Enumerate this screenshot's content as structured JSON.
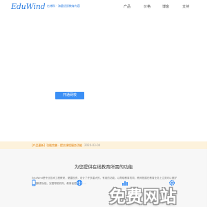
{
  "header": {
    "logo_text": "EduWind",
    "tagline": "亿博科 · 海量优质教育内容",
    "nav": {
      "products": "产品",
      "pricing": "价格",
      "blog": "博客",
      "support": "支持"
    }
  },
  "hero": {
    "cta_label": "开通网校"
  },
  "notice": {
    "tag": "[产品更新]",
    "title": "功能完善 · 提交课程服务功能",
    "date": "2020-03-04"
  },
  "features": {
    "title": "为您提供在线教育所需的功能",
    "description": "EduWind是专业技术工程教研，便捷投资，设计了许多重大的，有用的功能，以帮助教育机构，教师拓展在教育业务上立刻可以做好开展教课功能，完善帮助机构，教育者更好地……"
  },
  "watermark": {
    "text": "免费网站"
  },
  "colors": {
    "brand_blue": "#2b7de0",
    "button_blue": "#3b8ff5",
    "notice_bg": "#fdf2dc",
    "notice_text": "#e07b00",
    "features_bg": "#f7f7f7"
  },
  "icons": [
    "mobile-icon",
    "film-reel-icon",
    "chart-icon",
    "gear-icon"
  ]
}
